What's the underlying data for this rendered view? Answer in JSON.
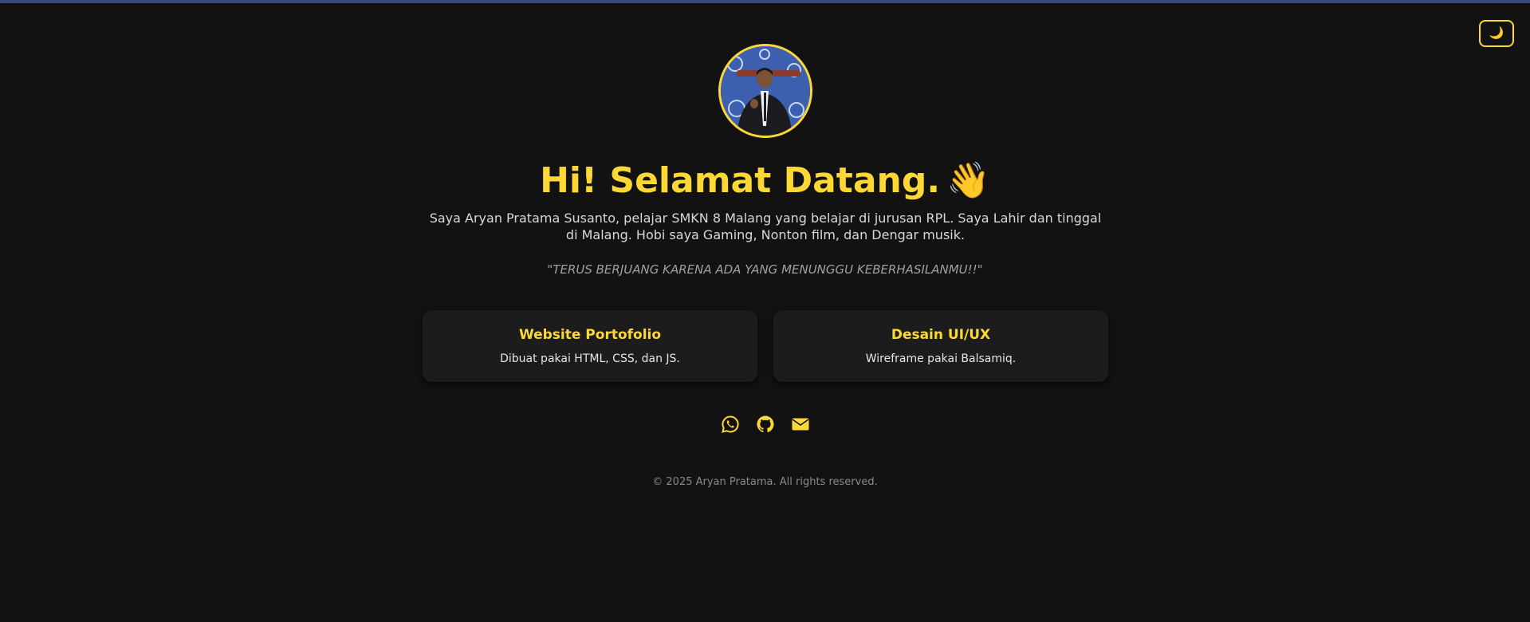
{
  "theme": {
    "accent": "#fdd835",
    "background": "#121212",
    "card_background": "#1c1c1c"
  },
  "toggle": {
    "icon": "moon-icon",
    "glyph": "🌙"
  },
  "avatar": {
    "icon": "profile-photo"
  },
  "hero": {
    "title": "Hi! Selamat Datang.",
    "wave": "👋",
    "bio": "Saya Aryan Pratama Susanto, pelajar SMKN 8 Malang yang belajar di jurusan RPL. Saya Lahir dan tinggal di Malang. Hobi saya Gaming, Nonton film, dan Dengar musik.",
    "quote": "\"TERUS BERJUANG KARENA ADA YANG MENUNGGU KEBERHASILANMU!!\""
  },
  "cards": [
    {
      "title": "Website Portofolio",
      "desc": "Dibuat pakai HTML, CSS, dan JS."
    },
    {
      "title": "Desain UI/UX",
      "desc": "Wireframe pakai Balsamiq."
    }
  ],
  "social": [
    {
      "icon": "whatsapp-icon"
    },
    {
      "icon": "github-icon"
    },
    {
      "icon": "email-icon"
    }
  ],
  "footer": {
    "text": "© 2025 Aryan Pratama. All rights reserved."
  }
}
